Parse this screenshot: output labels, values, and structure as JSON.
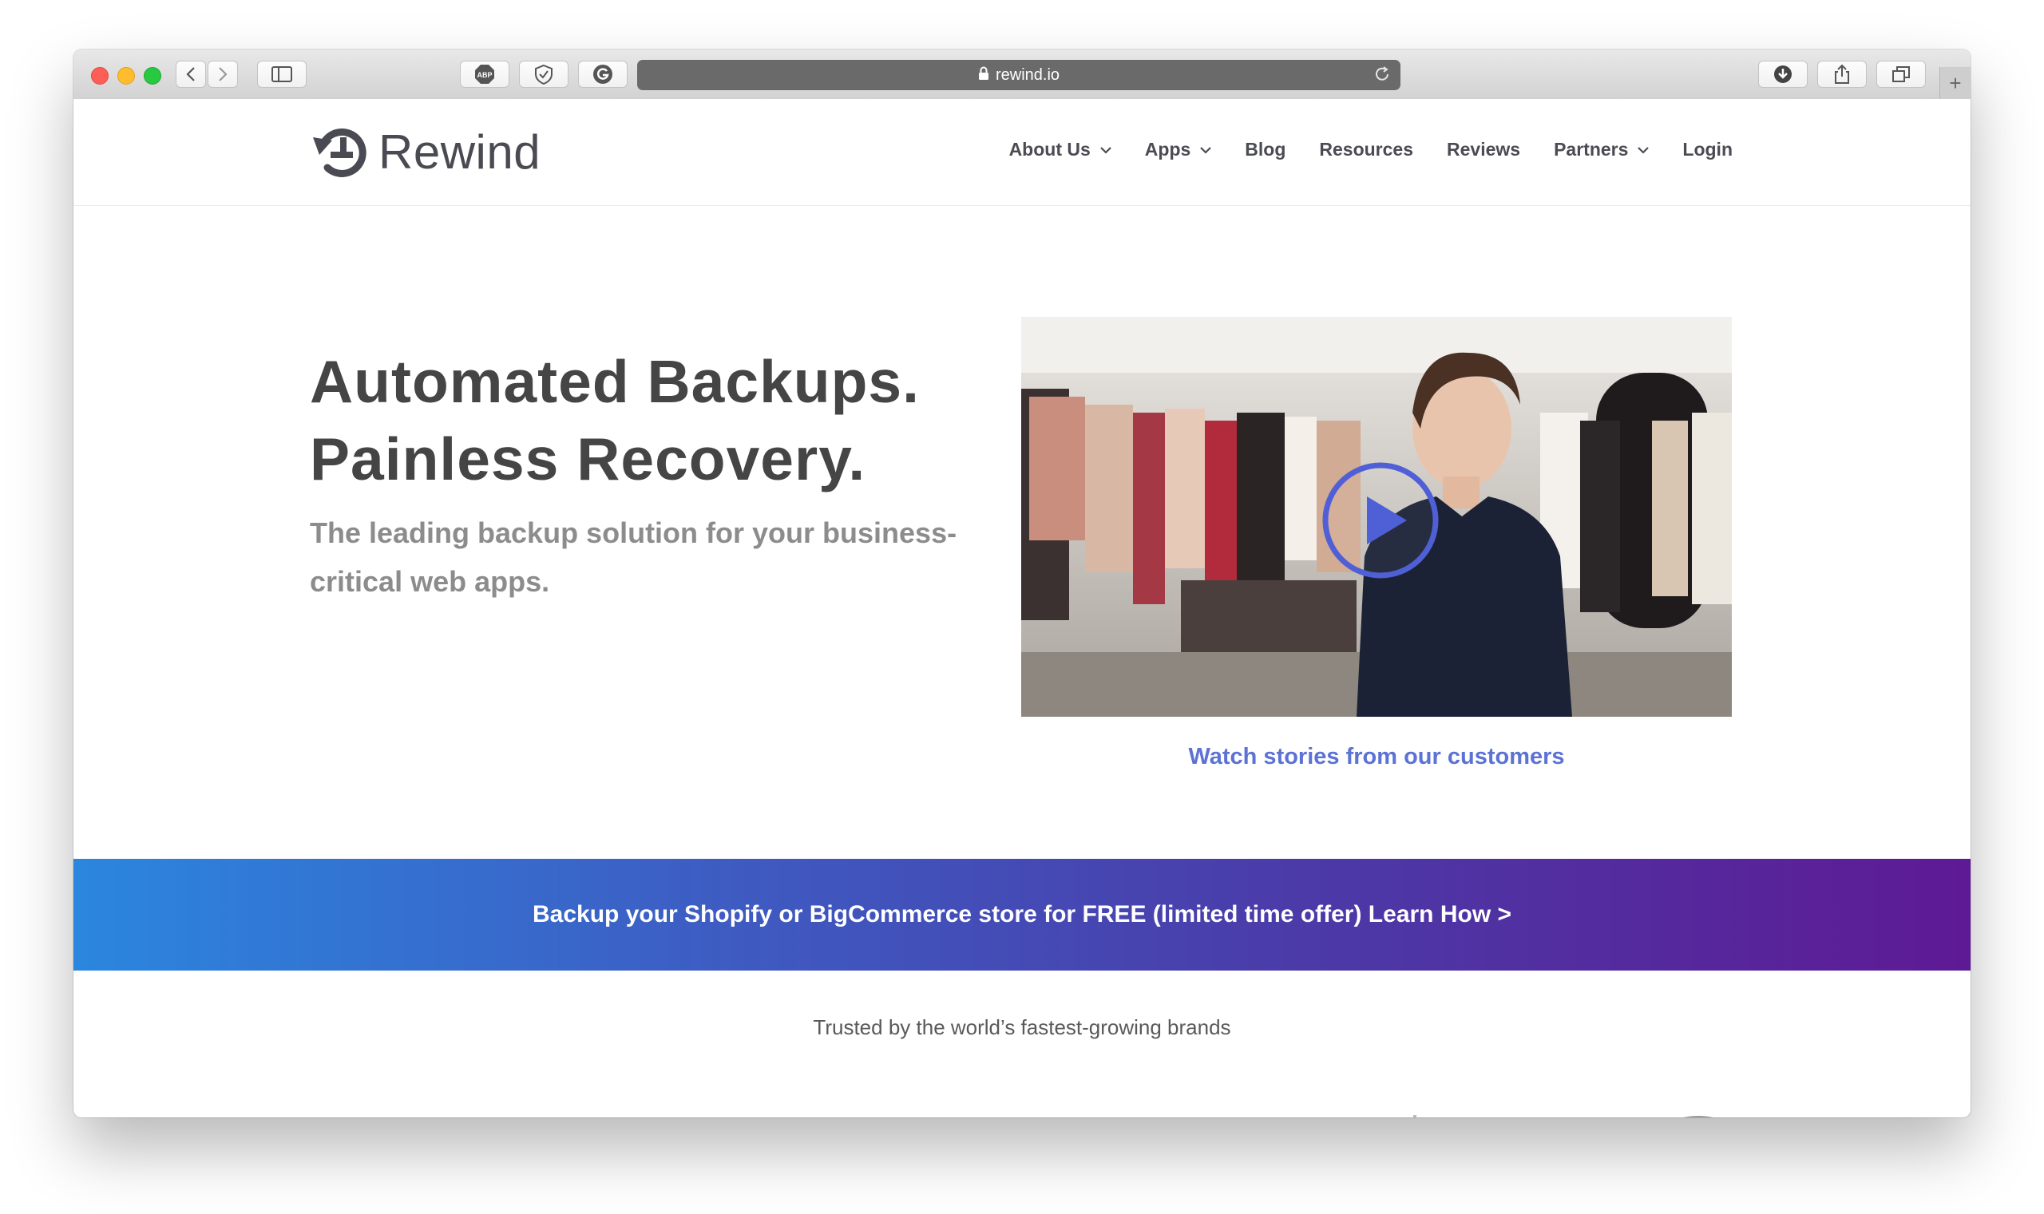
{
  "browser": {
    "url": "rewind.io"
  },
  "header": {
    "logo_text": "Rewind",
    "nav": [
      {
        "label": "About Us",
        "has_dropdown": true
      },
      {
        "label": "Apps",
        "has_dropdown": true
      },
      {
        "label": "Blog",
        "has_dropdown": false
      },
      {
        "label": "Resources",
        "has_dropdown": false
      },
      {
        "label": "Reviews",
        "has_dropdown": false
      },
      {
        "label": "Partners",
        "has_dropdown": true
      },
      {
        "label": "Login",
        "has_dropdown": false
      }
    ]
  },
  "hero": {
    "title_line1": "Automated Backups.",
    "title_line2": "Painless Recovery.",
    "subtitle": "The leading backup solution for your business-critical web apps.",
    "video_link": "Watch stories from our customers"
  },
  "banner": {
    "text": "Backup your Shopify or BigCommerce store for FREE (limited time offer) Learn How >"
  },
  "trusted": {
    "text": "Trusted by the world’s fastest-growing brands"
  },
  "colors": {
    "accent": "#5c72d4",
    "banner_start": "#2b86de",
    "banner_end": "#5e1a94",
    "title": "#454545",
    "subtitle": "#8c8c8c"
  }
}
